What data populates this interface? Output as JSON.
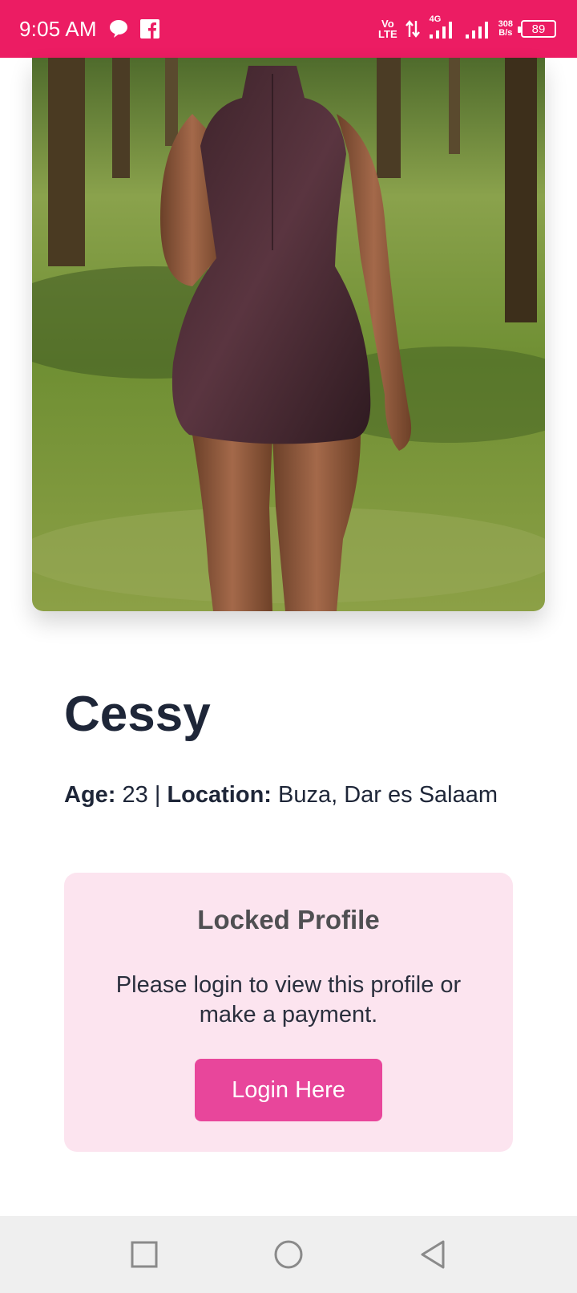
{
  "status_bar": {
    "time": "9:05 AM",
    "network_type_top": "Vo",
    "network_type_bottom": "LTE",
    "signal_label": "4G",
    "speed_value": "308",
    "speed_unit": "B/s",
    "battery": "89",
    "icons": [
      "message-icon",
      "facebook-icon",
      "data-arrows-icon",
      "signal-icon",
      "signal-icon-2"
    ]
  },
  "profile": {
    "name": "Cessy",
    "age_label": "Age:",
    "age_value": "23",
    "separator": "|",
    "location_label": "Location:",
    "location_value": "Buza, Dar es Salaam"
  },
  "locked": {
    "title": "Locked Profile",
    "message": "Please login to view this profile or make a payment.",
    "button_label": "Login Here"
  },
  "nav_bar": {
    "icons": [
      "recent-apps-icon",
      "home-icon",
      "back-icon"
    ]
  },
  "colors": {
    "status_bar": "#ec1c63",
    "button": "#e8469b",
    "locked_bg": "#fce4ef",
    "text_dark": "#1e2638"
  }
}
